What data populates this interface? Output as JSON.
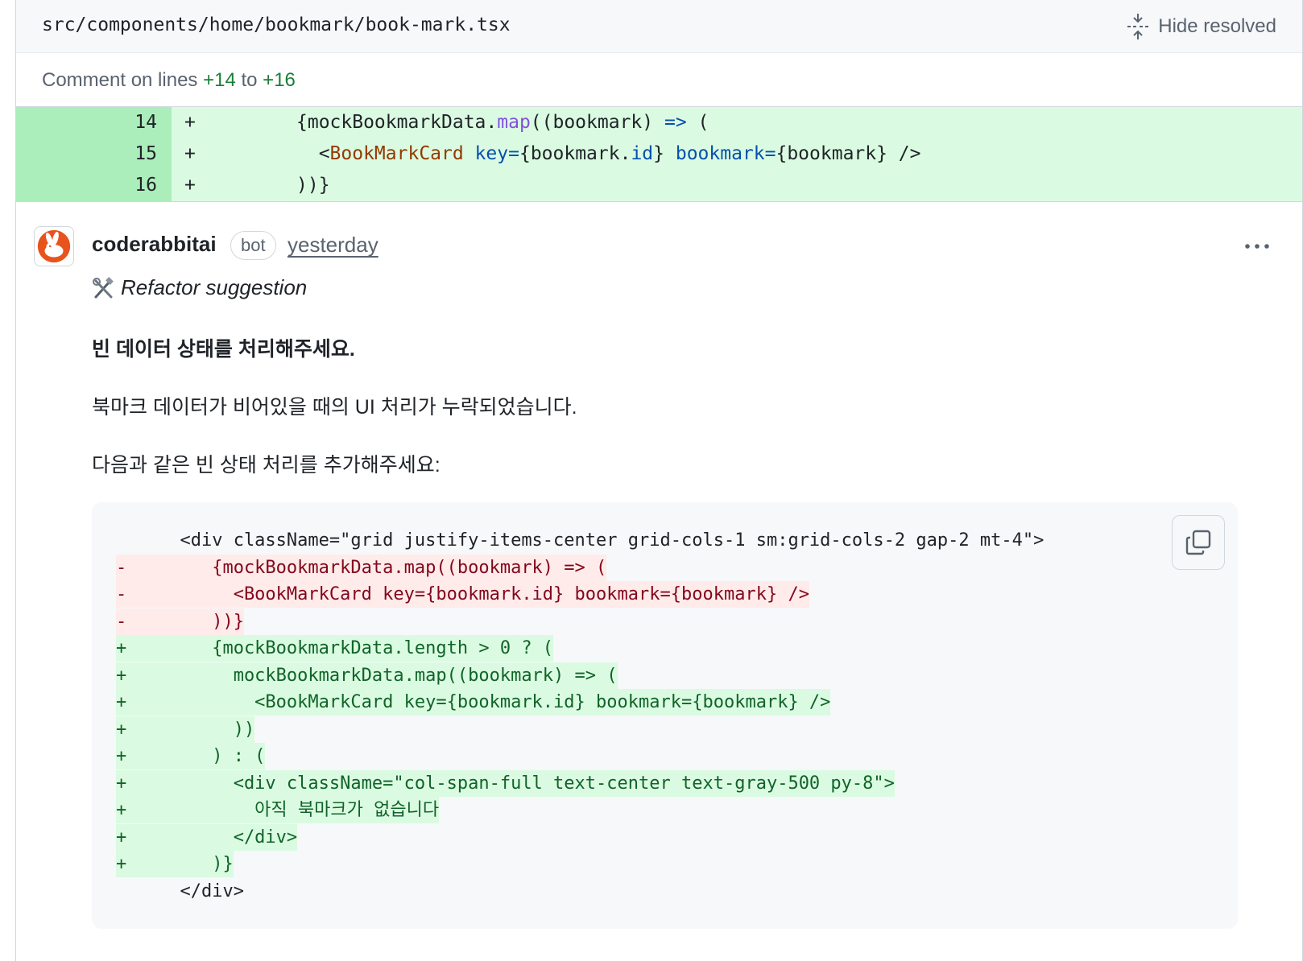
{
  "file": {
    "path": "src/components/home/bookmark/book-mark.tsx",
    "hide_resolved_label": "Hide resolved"
  },
  "comment_range": {
    "prefix": "Comment on lines",
    "start": "+14",
    "middle": "to",
    "end": "+16"
  },
  "diff": {
    "lines": [
      {
        "number": "14",
        "sign": "+",
        "parts": [
          "{mockBookmarkData.",
          "map",
          "((bookmark) ",
          "=>",
          " ("
        ]
      },
      {
        "number": "15",
        "sign": "+",
        "parts": [
          "  <",
          "BookMarkCard",
          " ",
          "key=",
          "{bookmark.",
          "id",
          "} ",
          "bookmark=",
          "{bookmark} />"
        ]
      },
      {
        "number": "16",
        "sign": "+",
        "parts": [
          "))}"
        ]
      }
    ]
  },
  "comment": {
    "author": "coderabbitai",
    "badge": "bot",
    "timestamp": "yesterday",
    "avatar_icon": "rabbit-icon",
    "accent_color": "#e8531d",
    "refactor_label": "Refactor suggestion",
    "heading": "빈 데이터 상태를 처리해주세요.",
    "paragraph1": "북마크 데이터가 비어있을 때의 UI 처리가 누락되었습니다.",
    "paragraph2": "다음과 같은 빈 상태 처리를 추가해주세요:",
    "code_lines": [
      {
        "type": "ctx",
        "text": "      <div className=\"grid justify-items-center grid-cols-1 sm:grid-cols-2 gap-2 mt-4\">"
      },
      {
        "type": "del",
        "text": "-        {mockBookmarkData.map((bookmark) => ("
      },
      {
        "type": "del",
        "text": "-          <BookMarkCard key={bookmark.id} bookmark={bookmark} />"
      },
      {
        "type": "del",
        "text": "-        ))}"
      },
      {
        "type": "add",
        "text": "+        {mockBookmarkData.length > 0 ? ("
      },
      {
        "type": "add",
        "text": "+          mockBookmarkData.map((bookmark) => ("
      },
      {
        "type": "add",
        "text": "+            <BookMarkCard key={bookmark.id} bookmark={bookmark} />"
      },
      {
        "type": "add",
        "text": "+          ))"
      },
      {
        "type": "add",
        "text": "+        ) : ("
      },
      {
        "type": "add",
        "text": "+          <div className=\"col-span-full text-center text-gray-500 py-8\">"
      },
      {
        "type": "add",
        "text": "+            아직 북마크가 없습니다"
      },
      {
        "type": "add",
        "text": "+          </div>"
      },
      {
        "type": "add",
        "text": "+        )}"
      },
      {
        "type": "ctx",
        "text": "      </div>"
      }
    ]
  }
}
